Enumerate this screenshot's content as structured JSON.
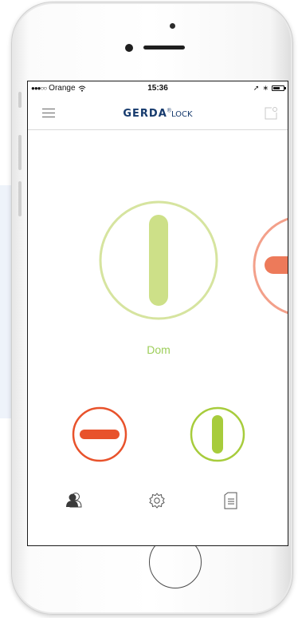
{
  "status_bar": {
    "carrier": "Orange",
    "time": "15:36"
  },
  "nav": {
    "brand": "GERDA",
    "brand_suffix": "LOCK",
    "registered_mark": "®"
  },
  "locks": [
    {
      "label": "Dom",
      "state": "unlocked"
    },
    {
      "label": "",
      "state": "locked"
    }
  ],
  "quick_locks": [
    {
      "state": "locked"
    },
    {
      "state": "unlocked"
    }
  ],
  "tab_bar": {
    "items": [
      "users-icon",
      "settings-icon",
      "document-icon"
    ]
  },
  "colors": {
    "green": "#cde088",
    "green_dark": "#a7cc3c",
    "red": "#e8522b",
    "salmon": "#f3a08a",
    "brand": "#163a6d"
  }
}
